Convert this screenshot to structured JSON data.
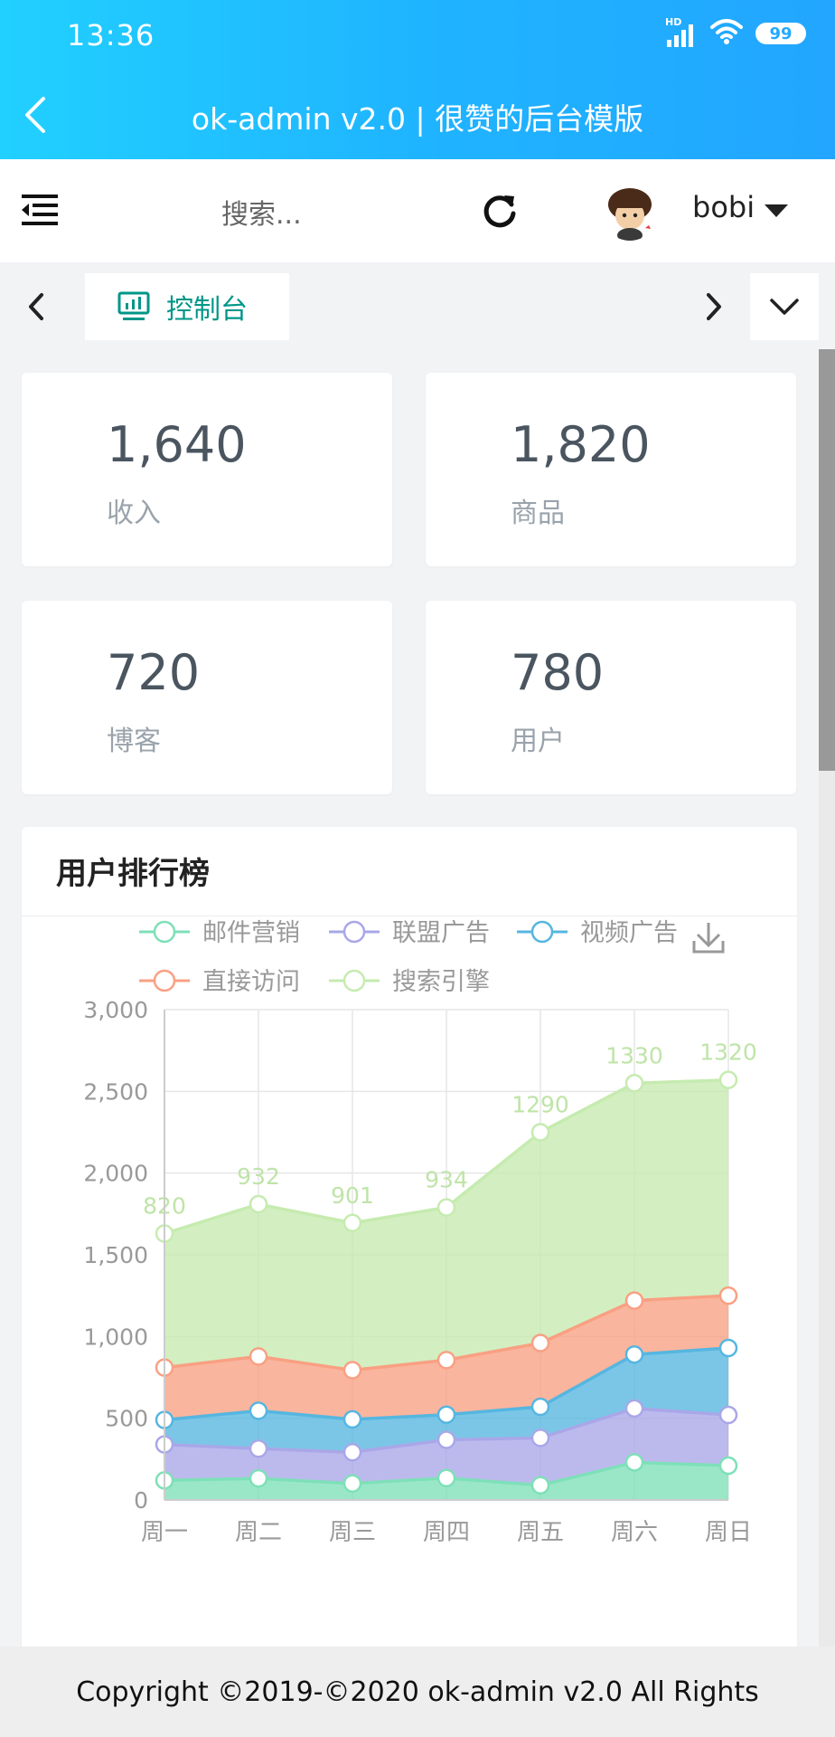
{
  "status_bar": {
    "time": "13:36",
    "network": "HD",
    "battery": "99"
  },
  "title_bar": {
    "title": "ok-admin v2.0 | 很赞的后台模版"
  },
  "header": {
    "search_placeholder": "搜索...",
    "username": "bobi"
  },
  "tabs": {
    "active_label": "控制台"
  },
  "stats": [
    {
      "value": "1,640",
      "label": "收入"
    },
    {
      "value": "1,820",
      "label": "商品"
    },
    {
      "value": "720",
      "label": "博客"
    },
    {
      "value": "780",
      "label": "用户"
    }
  ],
  "chart_card": {
    "title": "用户排行榜"
  },
  "chart_data": {
    "type": "area",
    "stacked": true,
    "categories": [
      "周一",
      "周二",
      "周三",
      "周四",
      "周五",
      "周六",
      "周日"
    ],
    "ylim": [
      0,
      3000
    ],
    "yticks": [
      "0",
      "500",
      "1,000",
      "1,500",
      "2,000",
      "2,500",
      "3,000"
    ],
    "grid": true,
    "legend_position": "top",
    "series": [
      {
        "name": "邮件营销",
        "color": "#7ee0b8",
        "values": [
          120,
          132,
          101,
          134,
          90,
          230,
          210
        ]
      },
      {
        "name": "联盟广告",
        "color": "#a9a7e8",
        "values": [
          220,
          182,
          191,
          234,
          290,
          330,
          310
        ]
      },
      {
        "name": "视频广告",
        "color": "#56b6e0",
        "values": [
          150,
          232,
          201,
          154,
          190,
          330,
          410
        ]
      },
      {
        "name": "直接访问",
        "color": "#f9a083",
        "values": [
          320,
          332,
          301,
          334,
          390,
          330,
          320
        ]
      },
      {
        "name": "搜索引擎",
        "color": "#c6ebb0",
        "values": [
          820,
          932,
          901,
          934,
          1290,
          1330,
          1320
        ]
      }
    ],
    "data_labels_series": "搜索引擎"
  },
  "footer": {
    "text": "Copyright ©2019-©2020 ok-admin v2.0 All Rights"
  }
}
